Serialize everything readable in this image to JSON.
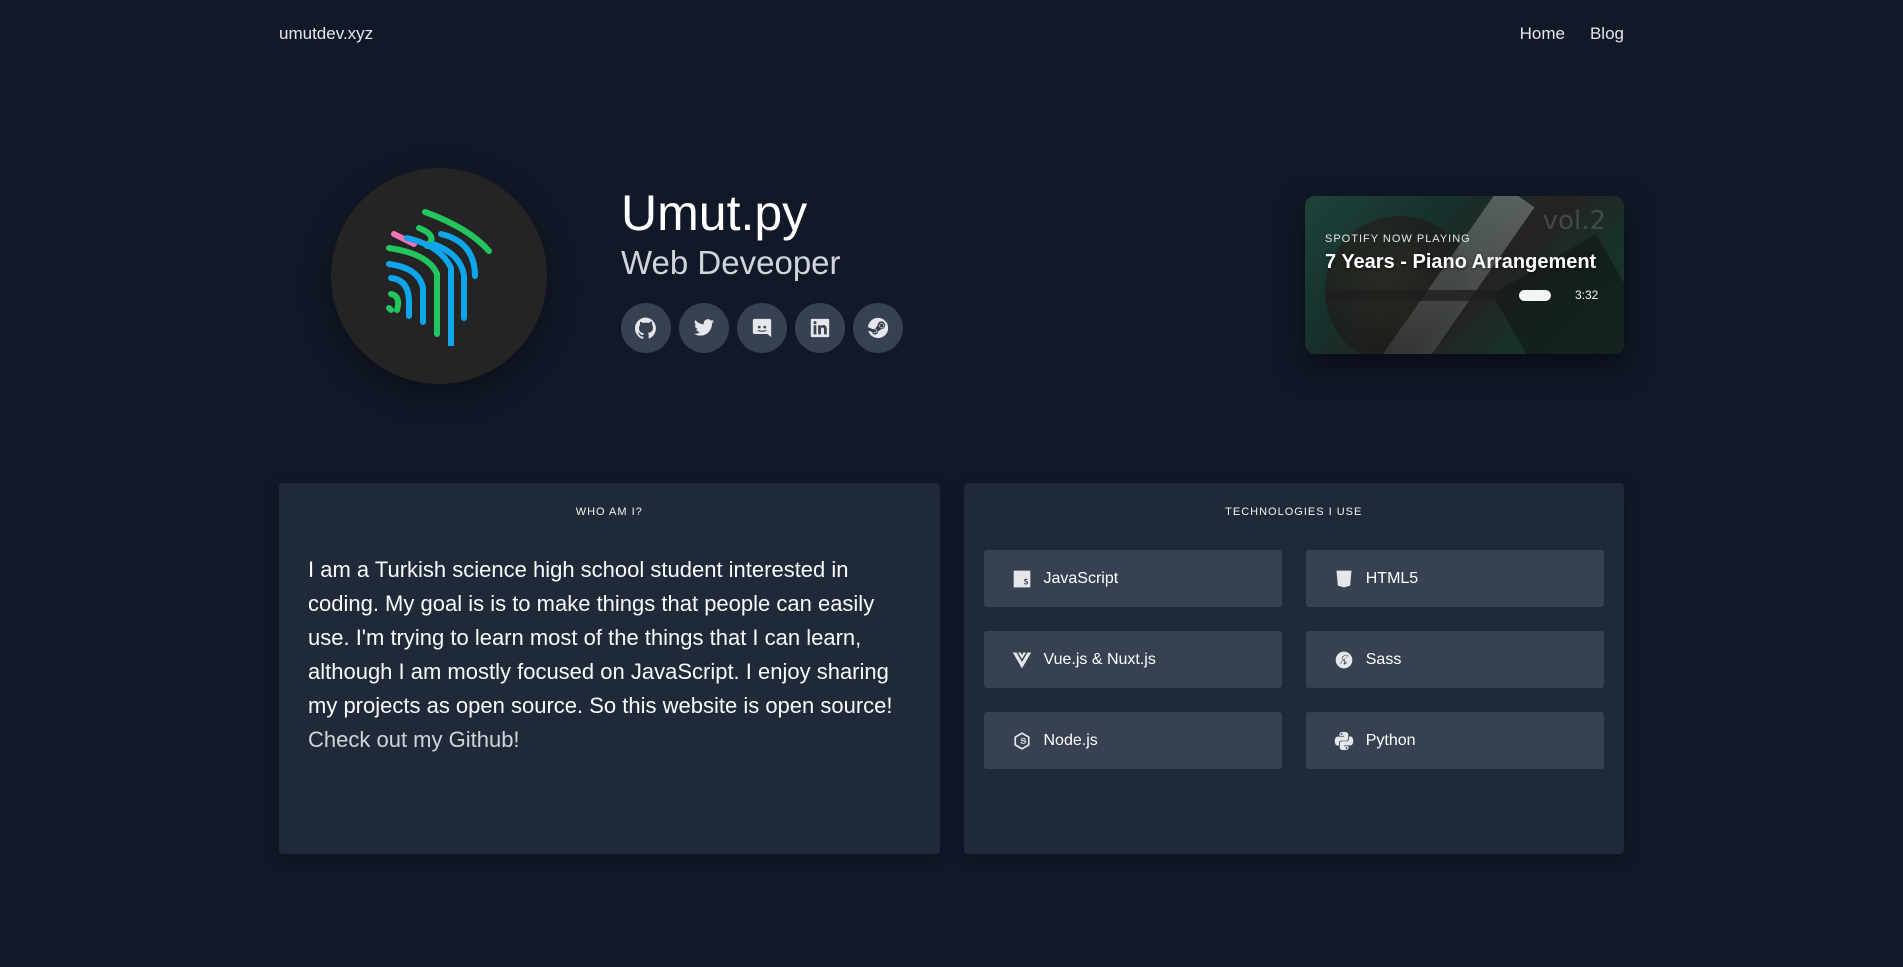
{
  "nav": {
    "brand": "umutdev.xyz",
    "links": [
      {
        "label": "Home"
      },
      {
        "label": "Blog"
      }
    ]
  },
  "hero": {
    "name": "Umut.py",
    "role": "Web Deveoper",
    "avatar_icon": "logo-lines",
    "socials": [
      {
        "icon": "github-icon"
      },
      {
        "icon": "twitter-icon"
      },
      {
        "icon": "discord-icon"
      },
      {
        "icon": "linkedin-icon"
      },
      {
        "icon": "steam-icon"
      }
    ]
  },
  "spotify": {
    "label": "SPOTIFY NOW PLAYING",
    "title": "7 Years - Piano Arrangement",
    "progress_from_end": 0.14,
    "time": "3:32",
    "art_text": "vol.2"
  },
  "about": {
    "title": "WHO AM I?",
    "text": "I am a Turkish science high school student interested in coding. My goal is is to make things that people can easily use. I'm trying to learn most of the things that I can learn, although I am mostly focused on JavaScript. I enjoy sharing my projects as open source. So this website is open source!",
    "link": "Check out my Github!"
  },
  "technologies": {
    "title": "TECHNOLOGIES I USE",
    "items": [
      {
        "label": "JavaScript",
        "icon": "javascript-icon"
      },
      {
        "label": "HTML5",
        "icon": "html5-icon"
      },
      {
        "label": "Vue.js & Nuxt.js",
        "icon": "vue-icon"
      },
      {
        "label": "Sass",
        "icon": "sass-icon"
      },
      {
        "label": "Node.js",
        "icon": "nodejs-icon"
      },
      {
        "label": "Python",
        "icon": "python-icon"
      }
    ]
  },
  "colors": {
    "background": "#111827",
    "card": "#1f2937",
    "chip": "#374151",
    "logo_green": "#22c55e",
    "logo_blue": "#0ea5e9",
    "logo_pink": "#f472b6"
  }
}
